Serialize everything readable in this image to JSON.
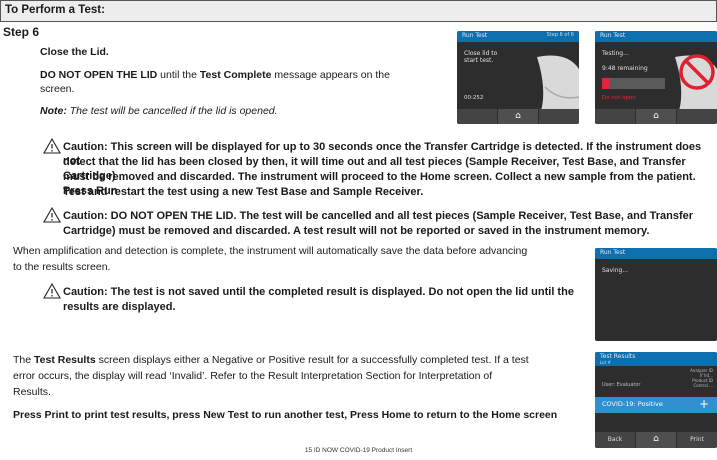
{
  "header": {
    "title": "To Perform a Test:"
  },
  "step": "Step 6",
  "close_lid": "Close the Lid.",
  "donot": {
    "bold1": "DO NOT OPEN THE LID",
    "mid": " until the ",
    "bold2": "Test Complete",
    "end": " message appears on the",
    "line2": "screen."
  },
  "note": {
    "label": "Note:",
    "text": " The test will be cancelled if the lid is opened."
  },
  "caution1": [
    "Caution: This screen will be displayed for up to 30 seconds once the Transfer Cartridge is detected. If the instrument does not",
    "detect that the lid has been closed by then, it will time out and all test pieces (Sample Receiver, Test Base, and Transfer Cartridge)",
    "must be removed and discarded. The instrument will proceed to the Home screen. Collect a new sample from the patient. Press Run",
    "Test and restart the test using a new Test Base and Sample Receiver."
  ],
  "caution2": [
    "Caution: DO NOT OPEN THE LID. The test will be cancelled and all test pieces (Sample Receiver, Test Base, and Transfer",
    "Cartridge) must be removed and discarded. A test result will not be reported or saved in the instrument memory."
  ],
  "amplification": [
    "When amplification and detection is complete, the instrument will automatically save the data before advancing",
    "to the results screen."
  ],
  "caution3": [
    "Caution: The test is not saved until the completed result is displayed. Do not open the lid until the",
    "results are displayed."
  ],
  "results": {
    "p1a": "The ",
    "p1b": "Test Results",
    "p1c": " screen displays either a Negative or Positive result for a successfully completed test. If a test",
    "line2": "error occurs, the display will read ‘Invalid’. Refer to the Result Interpretation Section for Interpretation of",
    "line3": "Results."
  },
  "print_line": "Press Print to print test results, press New Test to run another test, Press Home to return to the Home screen",
  "footer": "15   ID NOW COVID-19 Product Insert",
  "screens": {
    "s1": {
      "title": "Run Test",
      "right": "Step 6 of 6",
      "l1": "Close lid to",
      "l2": "start test.",
      "timer": "00:252"
    },
    "s2": {
      "title": "Run Test",
      "testing": "Testing...",
      "remaining": "9:48 remaining",
      "warning": "Do not open"
    },
    "s3": {
      "title": "Run Test",
      "saving": "Saving..."
    },
    "s4": {
      "title": "Test Results",
      "sub": "Lot #",
      "user": "User: Evaluator",
      "meta": [
        "Analyzer ID",
        "If hit...",
        "Product ID",
        "Control ..."
      ],
      "result": "COVID-19: Positive",
      "plus": "+",
      "back": "Back",
      "print": "Print"
    }
  },
  "colors": {
    "screen_bar": "#0e6fae",
    "screen_bg": "#2d2d2d",
    "progress": "#e8223a",
    "result_bar": "#2f8fcf",
    "no_sign": "#e0202e"
  },
  "icons": [
    "warning-triangle-icon",
    "home-icon",
    "no-entry-icon"
  ]
}
